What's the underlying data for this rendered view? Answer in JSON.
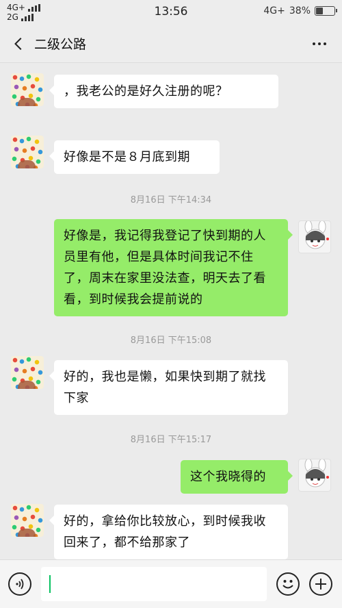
{
  "status_bar": {
    "network_top": "4G+",
    "network_bottom": "2G",
    "time": "13:56",
    "network_right": "4G+",
    "battery_percent": 38,
    "battery_label": "38%"
  },
  "header": {
    "title": "二级公路",
    "back_icon": "chevron-left-icon",
    "more_icon": "ellipsis-icon"
  },
  "messages": [
    {
      "side": "in",
      "text": "，我老公的是好久注册的呢？"
    },
    {
      "side": "in",
      "text": "好像是不是８月底到期"
    },
    {
      "type": "time",
      "text": "8月16日 下午14:34"
    },
    {
      "side": "out",
      "text": "好像是，我记得我登记了快到期的人员里有他，但是具体时间我记不住了，周末在家里没法查，明天去了看看，到时候我会提前说的"
    },
    {
      "type": "time",
      "text": "8月16日 下午15:08"
    },
    {
      "side": "in",
      "text": "好的，我也是懒，如果快到期了就找下家"
    },
    {
      "type": "time",
      "text": "8月16日 下午15:17"
    },
    {
      "side": "out",
      "text": "这个我晓得的"
    },
    {
      "side": "in",
      "text": "好的，拿给你比较放心，到时候我收回来了，都不给那家了"
    }
  ],
  "input_bar": {
    "voice_icon": "voice-icon",
    "emoji_icon": "emoji-icon",
    "plus_icon": "plus-icon",
    "input_value": ""
  },
  "colors": {
    "outgoing_bubble": "#95ec69",
    "incoming_bubble": "#ffffff",
    "background": "#ebebeb"
  }
}
